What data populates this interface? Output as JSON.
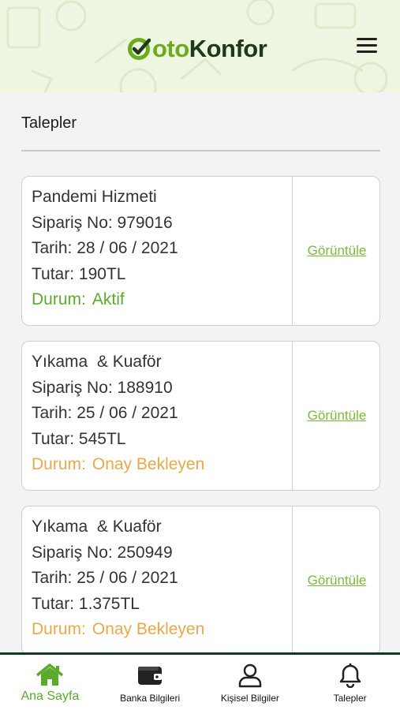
{
  "header": {
    "brand_prefix": "oto",
    "brand_suffix": "Konfor",
    "brand_color": "#6aac1e",
    "menu_icon": "hamburger-icon"
  },
  "page": {
    "title": "Talepler"
  },
  "orders": [
    {
      "service": "Pandemi Hizmeti",
      "order_label": "Sipariş No:",
      "order_no": "979016",
      "date_label": "Tarih:",
      "date": "28 / 06 / 2021",
      "amount_label": "Tutar:",
      "amount": "190TL",
      "status_label": "Durum:",
      "status": "Aktif",
      "status_color": "#5aaa2d",
      "action": "Görüntüle"
    },
    {
      "service": "Yıkama  & Kuaför",
      "order_label": "Sipariş No:",
      "order_no": "188910",
      "date_label": "Tarih:",
      "date": "25 / 06 / 2021",
      "amount_label": "Tutar:",
      "amount": "545TL",
      "status_label": "Durum:",
      "status": "Onay Bekleyen",
      "status_color": "#e9a94a",
      "action": "Görüntüle"
    },
    {
      "service": "Yıkama  & Kuaför",
      "order_label": "Sipariş No:",
      "order_no": "250949",
      "date_label": "Tarih:",
      "date": "25 / 06 / 2021",
      "amount_label": "Tutar:",
      "amount": "1.375TL",
      "status_label": "Durum:",
      "status": "Onay Bekleyen",
      "status_color": "#e9a94a",
      "action": "Görüntüle"
    }
  ],
  "bottom_nav": [
    {
      "label": "Ana Sayfa",
      "icon": "home-icon",
      "active": true
    },
    {
      "label": "Banka Bilgileri",
      "icon": "wallet-icon",
      "active": false
    },
    {
      "label": "Kişisel Bilgiler",
      "icon": "user-icon",
      "active": false
    },
    {
      "label": "Talepler",
      "icon": "bell-icon",
      "active": false
    }
  ],
  "colors": {
    "accent_green": "#6aac1e",
    "dark_green": "#0f3b1e",
    "pending_orange": "#e9a94a"
  }
}
